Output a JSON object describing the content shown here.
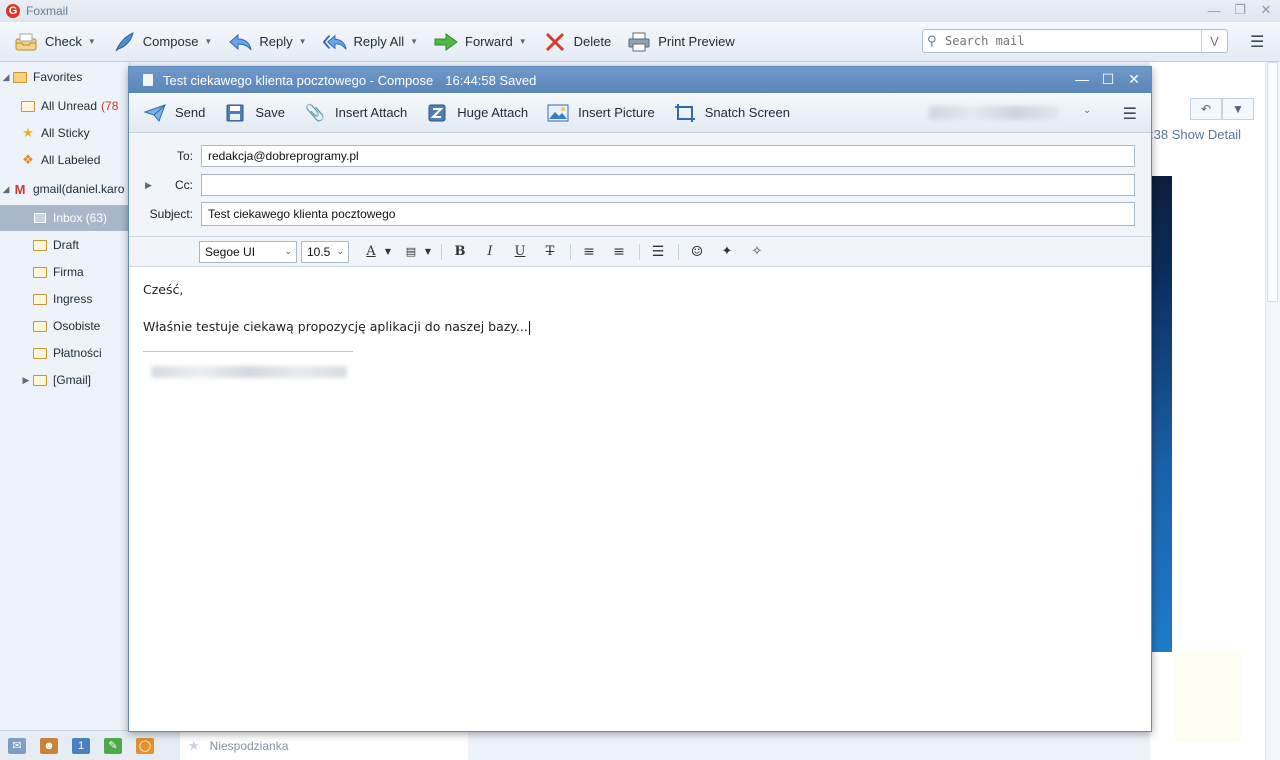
{
  "app": {
    "title": "Foxmail"
  },
  "toolbar": {
    "check": "Check",
    "compose": "Compose",
    "reply": "Reply",
    "reply_all": "Reply All",
    "forward": "Forward",
    "delete": "Delete",
    "print_preview": "Print Preview",
    "search_placeholder": "Search mail"
  },
  "sidebar": {
    "favorites": "Favorites",
    "all_unread": "All Unread",
    "all_unread_count": "(78",
    "all_sticky": "All Sticky",
    "all_labeled": "All Labeled",
    "account": "gmail(daniel.karo",
    "inbox": "Inbox (63)",
    "folders": [
      "Draft",
      "Firma",
      "Ingress",
      "Osobiste",
      "Płatności",
      "[Gmail]"
    ]
  },
  "list": {
    "bottom_item": "Niespodzianka"
  },
  "reading": {
    "time_fragment": ":38",
    "show_detail": "Show Detail"
  },
  "compose": {
    "title": "Test ciekawego klienta pocztowego - Compose",
    "saved": "16:44:58 Saved",
    "toolbar": {
      "send": "Send",
      "save": "Save",
      "insert_attach": "Insert Attach",
      "huge_attach": "Huge Attach",
      "insert_picture": "Insert Picture",
      "snatch_screen": "Snatch Screen"
    },
    "to_label": "To:",
    "to_value": "redakcja@dobreprogramy.pl",
    "cc_label": "Cc:",
    "cc_value": "",
    "subject_label": "Subject:",
    "subject_value": "Test ciekawego klienta pocztowego",
    "format": {
      "font": "Segoe UI",
      "size": "10.5"
    },
    "body": {
      "line1": "Cześć,",
      "line2": "Właśnie testuje ciekawą propozycję aplikacji do naszej bazy..."
    }
  }
}
